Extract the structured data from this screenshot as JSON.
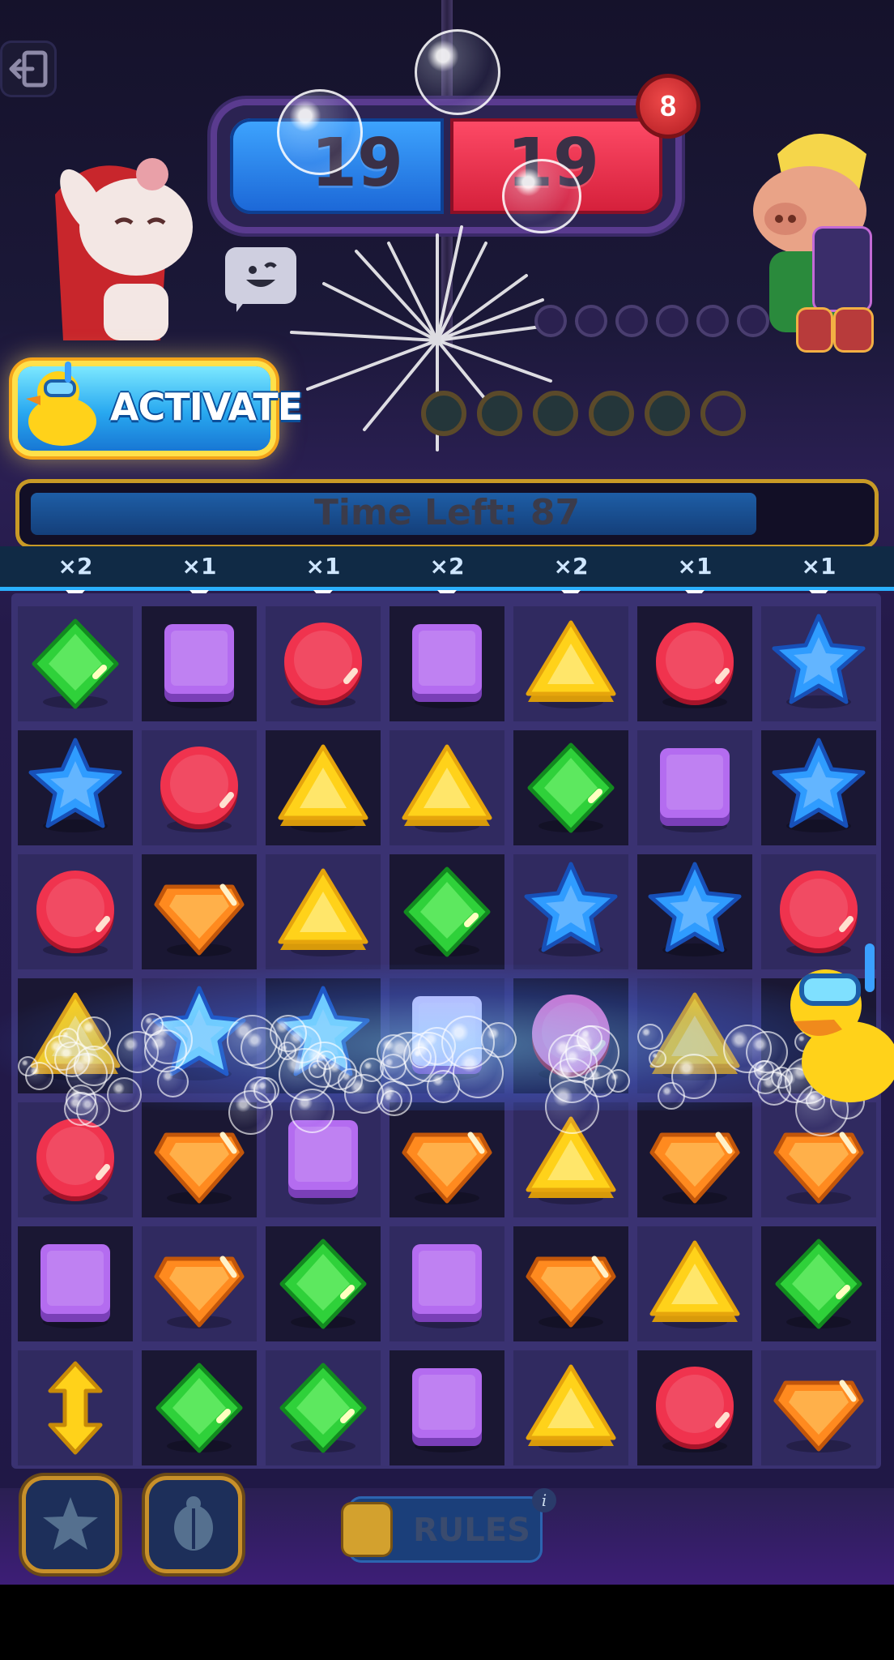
{
  "score": {
    "blue": "19",
    "red": "19"
  },
  "opponent_moves": "8",
  "activate_label": "ACTIVATE",
  "timer": {
    "label": "Time Left: 87",
    "remaining_fraction": 0.87
  },
  "multipliers": [
    "×2",
    "×1",
    "×1",
    "×2",
    "×2",
    "×1",
    "×1"
  ],
  "rules_label": "RULES",
  "info_glyph": "i",
  "colors": {
    "green": "#2fd13a",
    "purple": "#b46cf0",
    "red": "#f0334e",
    "yellow": "#ffd21a",
    "blue": "#2f9cff",
    "orange": "#ff8a1f",
    "pink": "#f07ac8",
    "lilac": "#dcd4ff",
    "cyan": "#7fe6ff"
  },
  "board": [
    [
      "green-diamond",
      "purple-square",
      "red-circle",
      "purple-square",
      "yellow-triangle",
      "red-circle",
      "blue-star"
    ],
    [
      "blue-star",
      "red-circle",
      "yellow-triangle",
      "yellow-triangle",
      "green-diamond",
      "purple-square",
      "blue-star"
    ],
    [
      "red-circle",
      "orange-gem",
      "yellow-triangle",
      "green-diamond",
      "blue-star",
      "blue-star",
      "red-circle"
    ],
    [
      "yellow-triangle",
      "cyan-star",
      "cyan-star",
      "lilac-square",
      "pink-circle",
      "yellow-triangle",
      ""
    ],
    [
      "red-circle",
      "orange-gem",
      "purple-square",
      "orange-gem",
      "yellow-triangle",
      "orange-gem",
      "orange-gem"
    ],
    [
      "purple-square",
      "orange-gem",
      "green-diamond",
      "purple-square",
      "orange-gem",
      "yellow-triangle",
      "green-diamond"
    ],
    [
      "vertical-arrow-powerup",
      "green-diamond",
      "green-diamond",
      "purple-square",
      "yellow-triangle",
      "red-circle",
      "orange-gem"
    ]
  ],
  "cell_shading": [
    [
      "light",
      "dark",
      "light",
      "dark",
      "light",
      "dark",
      "light"
    ],
    [
      "dark",
      "light",
      "dark",
      "light",
      "dark",
      "light",
      "dark"
    ],
    [
      "light",
      "dark",
      "light",
      "dark",
      "light",
      "dark",
      "light"
    ],
    [
      "dark",
      "light",
      "dark",
      "light",
      "dark",
      "light",
      "dark"
    ],
    [
      "light",
      "dark",
      "light",
      "dark",
      "light",
      "dark",
      "light"
    ],
    [
      "dark",
      "light",
      "dark",
      "light",
      "dark",
      "light",
      "dark"
    ],
    [
      "light",
      "dark",
      "light",
      "dark",
      "light",
      "dark",
      "light"
    ]
  ]
}
